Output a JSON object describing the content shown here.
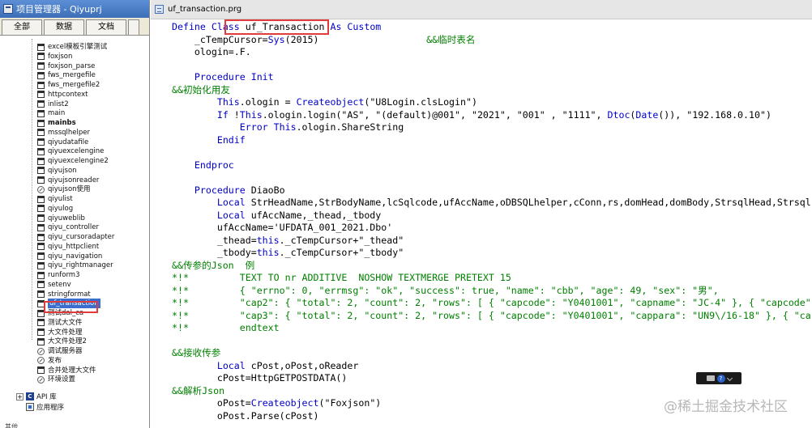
{
  "project_manager": {
    "title": "项目管理器 - Qiyuprj",
    "tabs": [
      "全部",
      "数据",
      "文档",
      ""
    ],
    "items": [
      {
        "label": "excel模板引擎测试",
        "bold": false,
        "icon": "file-icon"
      },
      {
        "label": "foxjson",
        "bold": false,
        "icon": "file-icon"
      },
      {
        "label": "foxjson_parse",
        "bold": false,
        "icon": "file-icon"
      },
      {
        "label": "fws_mergefile",
        "bold": false,
        "icon": "file-icon"
      },
      {
        "label": "fws_mergefile2",
        "bold": false,
        "icon": "file-icon"
      },
      {
        "label": "httpcontext",
        "bold": false,
        "icon": "file-icon"
      },
      {
        "label": "inlist2",
        "bold": false,
        "icon": "file-icon"
      },
      {
        "label": "main",
        "bold": false,
        "icon": "file-icon"
      },
      {
        "label": "mainbs",
        "bold": true,
        "icon": "file-icon"
      },
      {
        "label": "mssqlhelper",
        "bold": false,
        "icon": "file-icon"
      },
      {
        "label": "qiyudatafile",
        "bold": false,
        "icon": "file-icon"
      },
      {
        "label": "qiyuexcelengine",
        "bold": false,
        "icon": "file-icon"
      },
      {
        "label": "qiyuexcelengine2",
        "bold": false,
        "icon": "file-icon"
      },
      {
        "label": "qiyujson",
        "bold": false,
        "icon": "file-icon"
      },
      {
        "label": "qiyujsonreader",
        "bold": false,
        "icon": "file-icon"
      },
      {
        "label": "qiyujson使用",
        "bold": false,
        "icon": "excluded-icon"
      },
      {
        "label": "qiyulist",
        "bold": false,
        "icon": "file-icon"
      },
      {
        "label": "qiyulog",
        "bold": false,
        "icon": "file-icon"
      },
      {
        "label": "qiyuweblib",
        "bold": false,
        "icon": "file-icon"
      },
      {
        "label": "qiyu_controller",
        "bold": false,
        "icon": "file-icon"
      },
      {
        "label": "qiyu_cursoradapter",
        "bold": false,
        "icon": "file-icon"
      },
      {
        "label": "qiyu_httpclient",
        "bold": false,
        "icon": "file-icon"
      },
      {
        "label": "qiyu_navigation",
        "bold": false,
        "icon": "file-icon"
      },
      {
        "label": "qiyu_rightmanager",
        "bold": false,
        "icon": "file-icon"
      },
      {
        "label": "runform3",
        "bold": false,
        "icon": "file-icon"
      },
      {
        "label": "setenv",
        "bold": false,
        "icon": "file-icon"
      },
      {
        "label": "stringformat",
        "bold": false,
        "icon": "file-icon"
      },
      {
        "label": "uf_transaction",
        "bold": false,
        "icon": "file-icon",
        "selected": true
      },
      {
        "label": "测试dal_ca",
        "bold": false,
        "icon": "file-icon"
      },
      {
        "label": "测试大文件",
        "bold": false,
        "icon": "file-icon"
      },
      {
        "label": "大文件处理",
        "bold": false,
        "icon": "file-icon"
      },
      {
        "label": "大文件处理2",
        "bold": false,
        "icon": "file-icon"
      },
      {
        "label": "调试服务器",
        "bold": false,
        "icon": "excluded-icon"
      },
      {
        "label": "发布",
        "bold": false,
        "icon": "excluded-icon"
      },
      {
        "label": "合并处理大文件",
        "bold": false,
        "icon": "file-icon"
      },
      {
        "label": "环境设置",
        "bold": false,
        "icon": "excluded-icon"
      }
    ],
    "nodes": [
      {
        "label": "API 库",
        "icon": "class-library-icon",
        "expand": "+"
      },
      {
        "label": "应用程序",
        "icon": "application-icon",
        "expand": ""
      }
    ],
    "footer_label": "其他"
  },
  "editor": {
    "title": "uf_transaction.prg",
    "lines": [
      [
        [
          "kw",
          "Define Class "
        ],
        [
          "",
          "uf_Transaction"
        ],
        [
          "kw",
          " As Custom"
        ]
      ],
      [
        [
          "",
          "    _cTempCursor="
        ],
        [
          "fn",
          "Sys"
        ],
        [
          "",
          "(2015)"
        ],
        [
          "",
          "                   "
        ],
        [
          "cmt",
          "&&临时表名"
        ]
      ],
      [
        [
          "",
          "    ologin=.F."
        ]
      ],
      [
        [
          "",
          ""
        ]
      ],
      [
        [
          "kw",
          "    Procedure Init"
        ]
      ],
      [
        [
          "cmt",
          "&&初始化用友"
        ]
      ],
      [
        [
          "",
          "        "
        ],
        [
          "kw",
          "This"
        ],
        [
          "",
          ".ologin = "
        ],
        [
          "fn",
          "Createobject"
        ],
        [
          "",
          "(\"U8Login.clsLogin\")"
        ]
      ],
      [
        [
          "",
          "        "
        ],
        [
          "kw",
          "If"
        ],
        [
          "",
          " !"
        ],
        [
          "kw",
          "This"
        ],
        [
          "",
          ".ologin.login(\"AS\", \"(default)@001\", \"2021\", \"001\" , \"1111\", "
        ],
        [
          "fn",
          "Dtoc"
        ],
        [
          "",
          "("
        ],
        [
          "fn",
          "Date"
        ],
        [
          "",
          "()), \"192.168.0.10\")"
        ]
      ],
      [
        [
          "",
          "            "
        ],
        [
          "kw",
          "Error"
        ],
        [
          "",
          " "
        ],
        [
          "kw",
          "This"
        ],
        [
          "",
          ".ologin.ShareString"
        ]
      ],
      [
        [
          "",
          "        "
        ],
        [
          "kw",
          "Endif"
        ]
      ],
      [
        [
          "",
          ""
        ]
      ],
      [
        [
          "kw",
          "    Endproc"
        ]
      ],
      [
        [
          "",
          ""
        ]
      ],
      [
        [
          "kw",
          "    Procedure"
        ],
        [
          "",
          " DiaoBo"
        ]
      ],
      [
        [
          "",
          "        "
        ],
        [
          "kw",
          "Local"
        ],
        [
          "",
          " StrHeadName,StrBodyName,lcSqlcode,ufAccName,oDBSQLhelper,cConn,rs,domHead,domBody,StrsqlHead,Strsql"
        ]
      ],
      [
        [
          "",
          "        "
        ],
        [
          "kw",
          "Local"
        ],
        [
          "",
          " ufAccName,_thead,_tbody"
        ]
      ],
      [
        [
          "",
          "        ufAccName='UFDATA_001_2021.Dbo'"
        ]
      ],
      [
        [
          "",
          "        _thead="
        ],
        [
          "kw",
          "this"
        ],
        [
          "",
          "._cTempCursor+\"_thead\""
        ]
      ],
      [
        [
          "",
          "        _tbody="
        ],
        [
          "kw",
          "this"
        ],
        [
          "",
          "._cTempCursor+\"_tbody\""
        ]
      ],
      [
        [
          "cmt",
          "&&传参的Json  例"
        ]
      ],
      [
        [
          "cmt",
          "*!*         TEXT TO nr ADDITIVE  NOSHOW TEXTMERGE PRETEXT 15"
        ]
      ],
      [
        [
          "cmt",
          "*!*         { \"errno\": 0, \"errmsg\": \"ok\", \"success\": true, \"name\": \"cbb\", \"age\": 49, \"sex\": \"男\","
        ]
      ],
      [
        [
          "cmt",
          "*!*         \"cap2\": { \"total\": 2, \"count\": 2, \"rows\": [ { \"capcode\": \"Y0401001\", \"capname\": \"JC-4\" }, { \"capcode\""
        ]
      ],
      [
        [
          "cmt",
          "*!*         \"cap3\": { \"total\": 2, \"count\": 2, \"rows\": [ { \"capcode\": \"Y0401001\", \"cappara\": \"UN9\\/16-18\" }, { \"ca"
        ]
      ],
      [
        [
          "cmt",
          "*!*         endtext"
        ]
      ],
      [
        [
          "",
          ""
        ]
      ],
      [
        [
          "cmt",
          "&&接收传参"
        ]
      ],
      [
        [
          "",
          "        "
        ],
        [
          "kw",
          "Local"
        ],
        [
          "",
          " cPost,oPost,oReader"
        ]
      ],
      [
        [
          "",
          "        cPost=HttpGETPOSTDATA()"
        ]
      ],
      [
        [
          "cmt",
          "&&解析Json"
        ]
      ],
      [
        [
          "",
          "        oPost="
        ],
        [
          "fn",
          "Createobject"
        ],
        [
          "",
          "(\"Foxjson\")"
        ]
      ],
      [
        [
          "",
          "        oPost.Parse(cPost)"
        ]
      ]
    ]
  },
  "watermark": "@稀土掘金技术社区",
  "mini_toolbar": {
    "help": "?"
  },
  "colors": {
    "keyword": "#0000c8",
    "comment": "#008000",
    "highlight": "#e23b3b",
    "selection": "#3a6fd0"
  }
}
